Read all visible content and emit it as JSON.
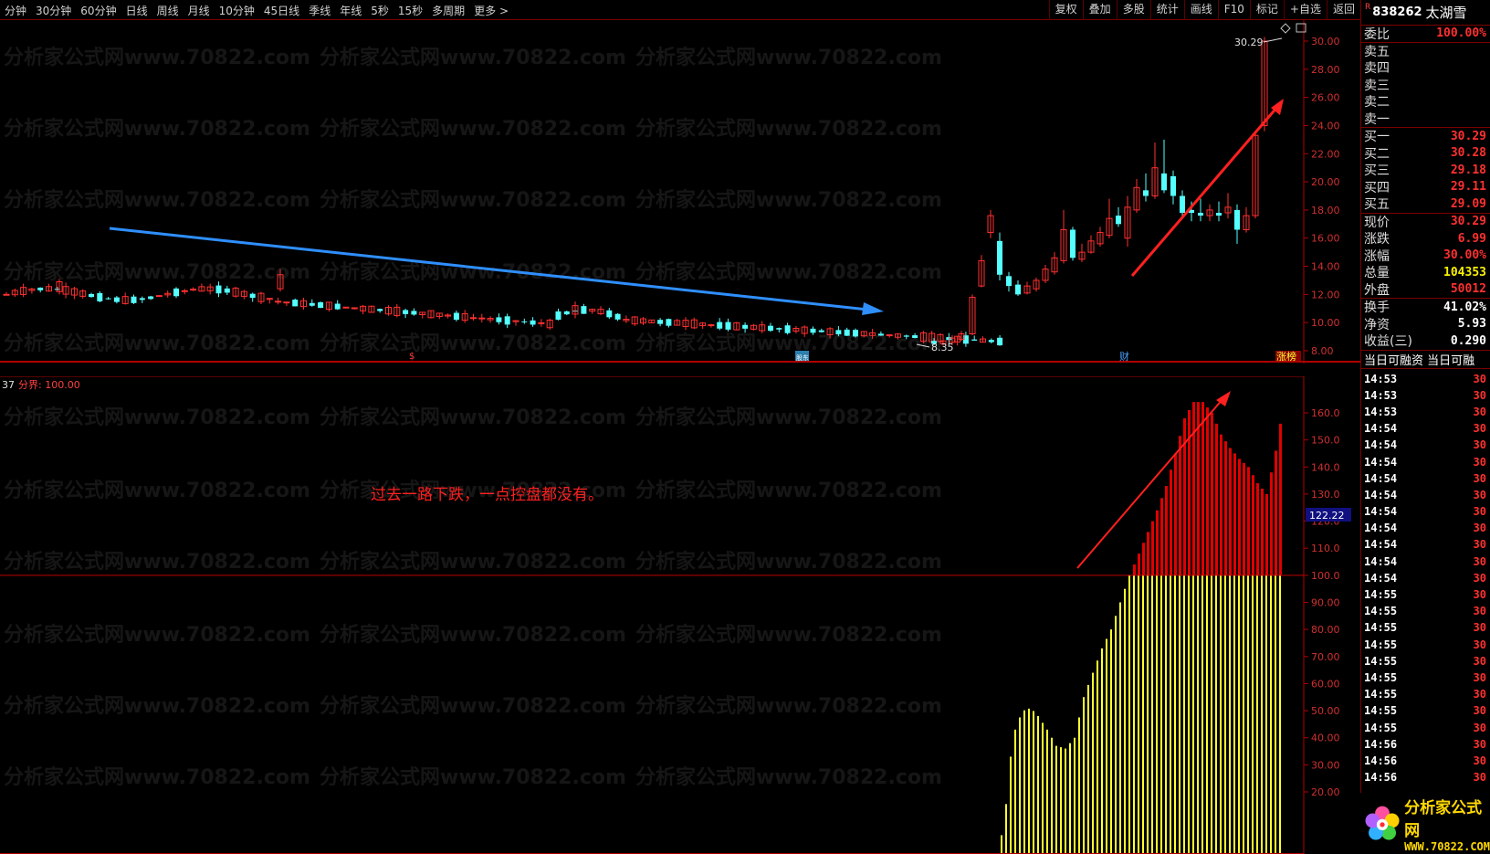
{
  "toolbar": {
    "periods": [
      "分钟",
      "30分钟",
      "60分钟",
      "日线",
      "周线",
      "月线",
      "10分钟",
      "45日线",
      "季线",
      "年线",
      "5秒",
      "15秒",
      "多周期",
      "更多 >"
    ],
    "tools": [
      "复权",
      "叠加",
      "多股",
      "统计",
      "画线",
      "F10",
      "标记",
      "+自选",
      "返回"
    ]
  },
  "main_chart": {
    "y_ticks": [
      "30.00",
      "28.00",
      "26.00",
      "24.00",
      "22.00",
      "20.00",
      "18.00",
      "16.00",
      "14.00",
      "12.00",
      "10.00",
      "8.00"
    ],
    "high_label": "30.29",
    "low_label": "8.35",
    "event_markers": [
      "$",
      "股东",
      "财",
      "涨榜"
    ],
    "watermark": "分析家公式网www.70822.com",
    "colors": {
      "up": "#ff3030",
      "down": "#54ffff",
      "trend_down": "#2f8fff",
      "trend_up": "#ff2020",
      "axis": "#b00000"
    }
  },
  "indicator": {
    "header_prefix": "37",
    "header_text": "分界: 100.00",
    "annotation": "过去一路下跌，一点控盘都没有。",
    "y_ticks": [
      "160.0",
      "150.0",
      "140.0",
      "130.0",
      "120.0",
      "110.0",
      "100.0",
      "90.00",
      "80.00",
      "70.00",
      "60.00",
      "50.00",
      "40.00",
      "30.00",
      "20.00"
    ],
    "current_value": "122.22",
    "threshold": 100,
    "colors": {
      "above": "#e00000",
      "below": "#ffff30"
    }
  },
  "quote": {
    "r_badge": "R",
    "code": "838262",
    "name": "太湖雪",
    "weibi": {
      "label": "委比",
      "value": "100.00%"
    },
    "sell": [
      {
        "label": "卖五",
        "value": ""
      },
      {
        "label": "卖四",
        "value": ""
      },
      {
        "label": "卖三",
        "value": ""
      },
      {
        "label": "卖二",
        "value": ""
      },
      {
        "label": "卖一",
        "value": ""
      }
    ],
    "buy": [
      {
        "label": "买一",
        "value": "30.29"
      },
      {
        "label": "买二",
        "value": "30.28"
      },
      {
        "label": "买三",
        "value": "29.18"
      },
      {
        "label": "买四",
        "value": "29.11"
      },
      {
        "label": "买五",
        "value": "29.09"
      }
    ],
    "stats": [
      {
        "label": "现价",
        "value": "30.29",
        "color": "red"
      },
      {
        "label": "涨跌",
        "value": "6.99",
        "color": "red"
      },
      {
        "label": "涨幅",
        "value": "30.00%",
        "color": "red"
      },
      {
        "label": "总量",
        "value": "104353",
        "color": "yel"
      },
      {
        "label": "外盘",
        "value": "50012",
        "color": "red"
      }
    ],
    "stats2": [
      {
        "label": "换手",
        "value": "41.02%",
        "color": "wht"
      },
      {
        "label": "净资",
        "value": "5.93",
        "color": "wht"
      },
      {
        "label": "收益(三)",
        "value": "0.290",
        "color": "wht"
      }
    ],
    "margin_header": "当日可融资 当日可融",
    "trades": [
      {
        "time": "14:53",
        "qty": "30"
      },
      {
        "time": "14:53",
        "qty": "30"
      },
      {
        "time": "14:53",
        "qty": "30"
      },
      {
        "time": "14:54",
        "qty": "30"
      },
      {
        "time": "14:54",
        "qty": "30"
      },
      {
        "time": "14:54",
        "qty": "30"
      },
      {
        "time": "14:54",
        "qty": "30"
      },
      {
        "time": "14:54",
        "qty": "30"
      },
      {
        "time": "14:54",
        "qty": "30"
      },
      {
        "time": "14:54",
        "qty": "30"
      },
      {
        "time": "14:54",
        "qty": "30"
      },
      {
        "time": "14:54",
        "qty": "30"
      },
      {
        "time": "14:54",
        "qty": "30"
      },
      {
        "time": "14:55",
        "qty": "30"
      },
      {
        "time": "14:55",
        "qty": "30"
      },
      {
        "time": "14:55",
        "qty": "30"
      },
      {
        "time": "14:55",
        "qty": "30"
      },
      {
        "time": "14:55",
        "qty": "30"
      },
      {
        "time": "14:55",
        "qty": "30"
      },
      {
        "time": "14:55",
        "qty": "30"
      },
      {
        "time": "14:55",
        "qty": "30"
      },
      {
        "time": "14:55",
        "qty": "30"
      },
      {
        "time": "14:56",
        "qty": "30"
      },
      {
        "time": "14:56",
        "qty": "30"
      },
      {
        "time": "14:56",
        "qty": "30"
      }
    ]
  },
  "logo": {
    "cn": "分析家公式网",
    "url": "WWW.70822.COM"
  }
}
